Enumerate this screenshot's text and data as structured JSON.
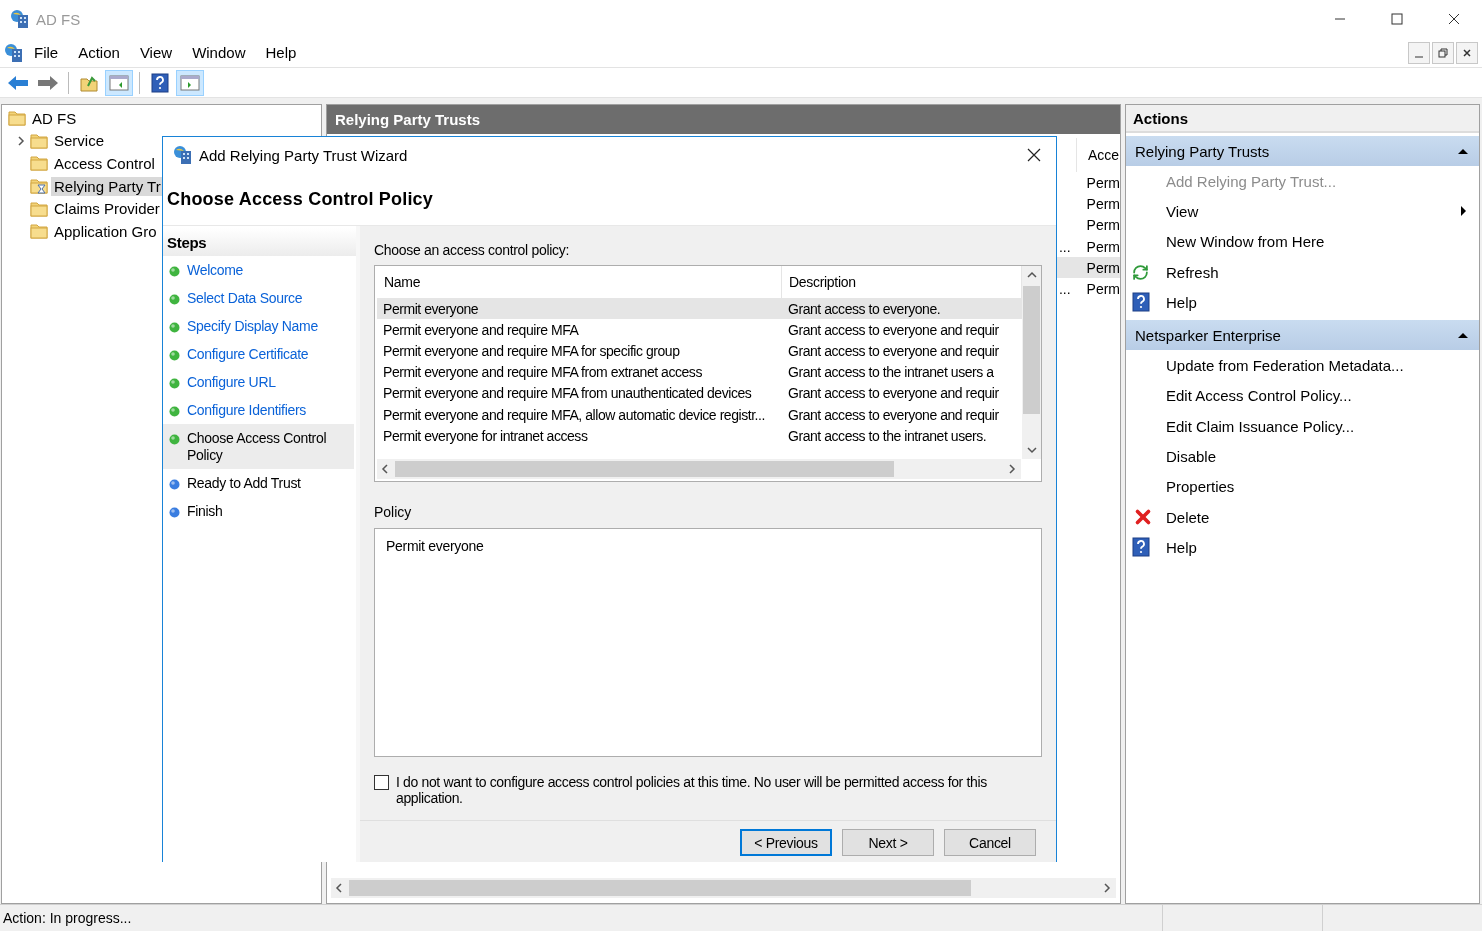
{
  "window": {
    "title": "AD FS"
  },
  "menu": [
    "File",
    "Action",
    "View",
    "Window",
    "Help"
  ],
  "toolbar": [
    {
      "kind": "back",
      "pressed": false
    },
    {
      "kind": "forward",
      "pressed": false
    },
    {
      "kind": "separator"
    },
    {
      "kind": "up",
      "pressed": false
    },
    {
      "kind": "show-tree",
      "pressed": true
    },
    {
      "kind": "separator"
    },
    {
      "kind": "help",
      "pressed": false
    },
    {
      "kind": "show-actions",
      "pressed": true
    }
  ],
  "tree": {
    "items": [
      {
        "label": "AD FS",
        "expander": false,
        "selected": false,
        "busy": false,
        "children": [
          {
            "label": "Service",
            "expander": true,
            "selected": false,
            "busy": false
          },
          {
            "label": "Access Control",
            "expander": false,
            "selected": false,
            "busy": false
          },
          {
            "label": "Relying Party Tr",
            "expander": false,
            "selected": true,
            "busy": true
          },
          {
            "label": "Claims Provider",
            "expander": false,
            "selected": false,
            "busy": false
          },
          {
            "label": "Application Gro",
            "expander": false,
            "selected": false,
            "busy": false
          }
        ]
      }
    ]
  },
  "center": {
    "title": "Relying Party Trusts",
    "column_2": "Acce",
    "rows": [
      {
        "column_1": "",
        "column_2": "Perm",
        "selected": false
      },
      {
        "column_1": "",
        "column_2": "Perm",
        "selected": false
      },
      {
        "column_1": "",
        "column_2": "Perm",
        "selected": false
      },
      {
        "column_1": "...",
        "column_2": "Perm",
        "selected": false
      },
      {
        "column_1": "",
        "column_2": "Perm",
        "selected": true
      },
      {
        "column_1": "...",
        "column_2": "Perm",
        "selected": false
      }
    ]
  },
  "wizard": {
    "title": "Add Relying Party Trust Wizard",
    "heading": "Choose Access Control Policy",
    "steps_title": "Steps",
    "steps": [
      {
        "label": "Welcome",
        "completed": true,
        "selected": false
      },
      {
        "label": "Select Data Source",
        "completed": true,
        "selected": false
      },
      {
        "label": "Specify Display Name",
        "completed": true,
        "selected": false
      },
      {
        "label": "Configure Certificate",
        "completed": true,
        "selected": false
      },
      {
        "label": "Configure URL",
        "completed": true,
        "selected": false
      },
      {
        "label": "Configure Identifiers",
        "completed": true,
        "selected": false
      },
      {
        "label": "Choose Access Control Policy",
        "completed": true,
        "selected": true
      },
      {
        "label": "Ready to Add Trust",
        "completed": false,
        "selected": false
      },
      {
        "label": "Finish",
        "completed": false,
        "selected": false
      }
    ],
    "list_label": "Choose an access control policy:",
    "columns": [
      "Name",
      "Description"
    ],
    "rows": [
      {
        "name": "Permit everyone",
        "description": "Grant access to everyone.",
        "selected": true
      },
      {
        "name": "Permit everyone and require MFA",
        "description": "Grant access to everyone and requir",
        "selected": false
      },
      {
        "name": "Permit everyone and require MFA for specific group",
        "description": "Grant access to everyone and requir",
        "selected": false
      },
      {
        "name": "Permit everyone and require MFA from extranet access",
        "description": "Grant access to the intranet users a",
        "selected": false
      },
      {
        "name": "Permit everyone and require MFA from unauthenticated devices",
        "description": "Grant access to everyone and requir",
        "selected": false
      },
      {
        "name": "Permit everyone and require MFA, allow automatic device registr...",
        "description": "Grant access to everyone and requir",
        "selected": false
      },
      {
        "name": "Permit everyone for intranet access",
        "description": "Grant access to the intranet users.",
        "selected": false
      }
    ],
    "policy_label": "Policy",
    "policy_text": "Permit everyone",
    "opt_out": {
      "label": "I do not want to configure access control policies at this time. No user will be permitted access for this application.",
      "checked": false
    },
    "buttons": [
      {
        "label": "< Previous",
        "default": true
      },
      {
        "label": "Next >",
        "default": false
      },
      {
        "label": "Cancel",
        "default": false
      }
    ]
  },
  "actions": {
    "title": "Actions",
    "groups": [
      {
        "title": "Relying Party Trusts",
        "expanded": true,
        "items": [
          {
            "label": "Add Relying Party Trust...",
            "kind": "plain",
            "disabled": true,
            "submenu": false
          },
          {
            "label": "View",
            "kind": "plain",
            "disabled": false,
            "submenu": true
          },
          {
            "label": "New Window from Here",
            "kind": "plain",
            "disabled": false,
            "submenu": false
          },
          {
            "label": "Refresh",
            "kind": "refresh",
            "disabled": false,
            "submenu": false
          },
          {
            "label": "Help",
            "kind": "help",
            "disabled": false,
            "submenu": false
          }
        ]
      },
      {
        "title": "Netsparker Enterprise",
        "expanded": true,
        "items": [
          {
            "label": "Update from Federation Metadata...",
            "kind": "plain",
            "disabled": false,
            "submenu": false
          },
          {
            "label": "Edit Access Control Policy...",
            "kind": "plain",
            "disabled": false,
            "submenu": false
          },
          {
            "label": "Edit Claim Issuance Policy...",
            "kind": "plain",
            "disabled": false,
            "submenu": false
          },
          {
            "label": "Disable",
            "kind": "plain",
            "disabled": false,
            "submenu": false
          },
          {
            "label": "Properties",
            "kind": "plain",
            "disabled": false,
            "submenu": false
          },
          {
            "label": "Delete",
            "kind": "delete",
            "disabled": false,
            "submenu": false
          },
          {
            "label": "Help",
            "kind": "help",
            "disabled": false,
            "submenu": false
          }
        ]
      }
    ]
  },
  "status_bar": {
    "text": "Action:  In progress..."
  }
}
